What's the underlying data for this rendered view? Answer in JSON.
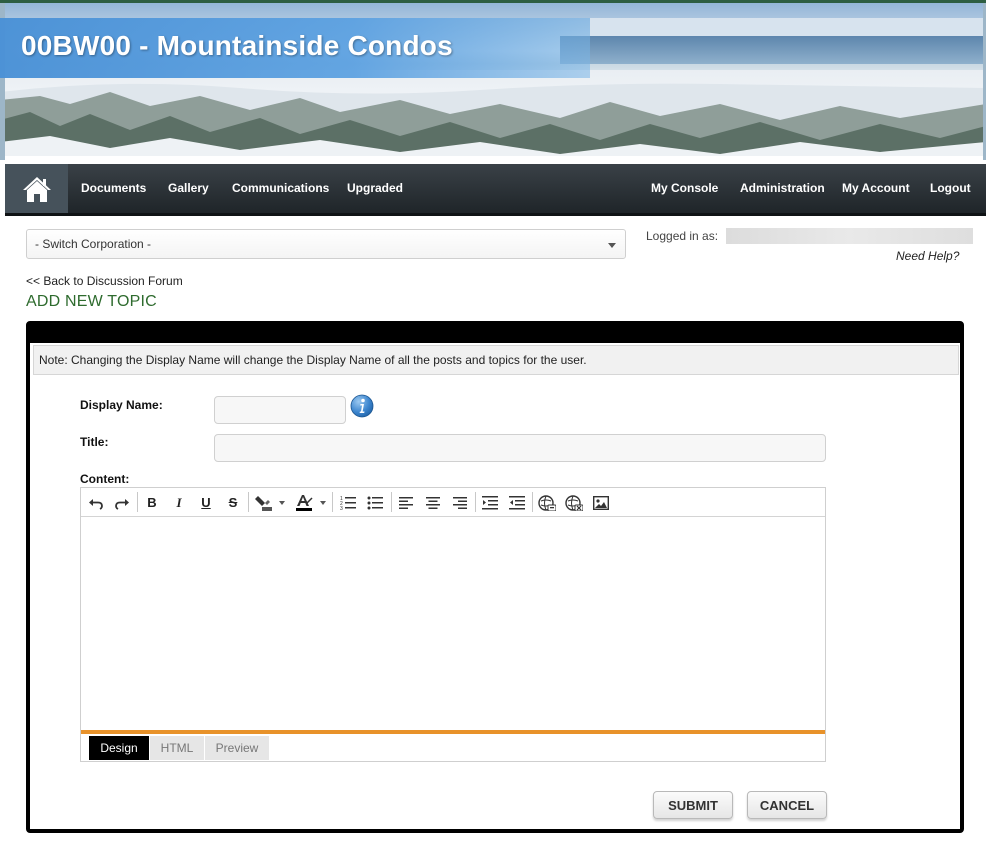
{
  "site": {
    "title": "00BW00 - Mountainside Condos"
  },
  "nav": {
    "home_icon": "home-icon",
    "left_items": [
      "Documents",
      "Gallery",
      "Communications",
      "Upgraded"
    ],
    "right_items": [
      "My Console",
      "Administration",
      "My Account",
      "Logout"
    ]
  },
  "corporation_select": {
    "selected": "- Switch Corporation -"
  },
  "session": {
    "logged_in_label": "Logged in as:",
    "help_link": "Need Help?"
  },
  "breadcrumb": {
    "back_link": "<< Back to Discussion Forum"
  },
  "page": {
    "title": "ADD NEW TOPIC"
  },
  "form": {
    "note": "Note:  Changing the Display Name will change the Display Name of all the posts and topics for the user.",
    "display_name_label": "Display Name:",
    "display_name_value": "",
    "title_label": "Title:",
    "title_value": "",
    "content_label": "Content:",
    "toolbar_icons": [
      "undo-icon",
      "redo-icon",
      "bold-icon",
      "italic-icon",
      "underline-icon",
      "strikethrough-icon",
      "highlight-color-icon",
      "font-color-icon",
      "ordered-list-icon",
      "unordered-list-icon",
      "align-left-icon",
      "align-center-icon",
      "align-right-icon",
      "indent-icon",
      "outdent-icon",
      "insert-link-icon",
      "remove-link-icon",
      "insert-image-icon"
    ],
    "mode_tabs": [
      "Design",
      "HTML",
      "Preview"
    ],
    "active_mode": "Design",
    "submit_label": "SUBMIT",
    "cancel_label": "CANCEL"
  },
  "colors": {
    "title_bar": "#4a91d6",
    "nav_bg": "#2a3136",
    "page_title": "#2e6b2e",
    "panel_border": "#000000",
    "editor_accent": "#e8922a"
  }
}
